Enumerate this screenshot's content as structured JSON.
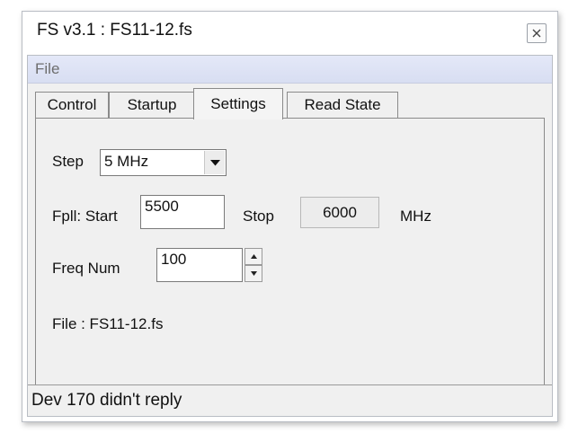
{
  "window": {
    "title": "FS v3.1 : FS11-12.fs"
  },
  "menu": {
    "items": [
      "File"
    ]
  },
  "tabs": [
    {
      "label": "Control",
      "active": false
    },
    {
      "label": "Startup",
      "active": false
    },
    {
      "label": "Settings",
      "active": true
    },
    {
      "label": "Read State",
      "active": false
    }
  ],
  "settings": {
    "step_label": "Step",
    "step_value": "5 MHz",
    "fpll_start_label": "Fpll: Start",
    "fpll_start_value": "5500",
    "stop_label": "Stop",
    "stop_value": "6000",
    "unit_label": "MHz",
    "freq_num_label": "Freq Num",
    "freq_num_value": "100",
    "file_label": "File : FS11-12.fs"
  },
  "status": {
    "text": "Dev 170 didn't reply"
  }
}
